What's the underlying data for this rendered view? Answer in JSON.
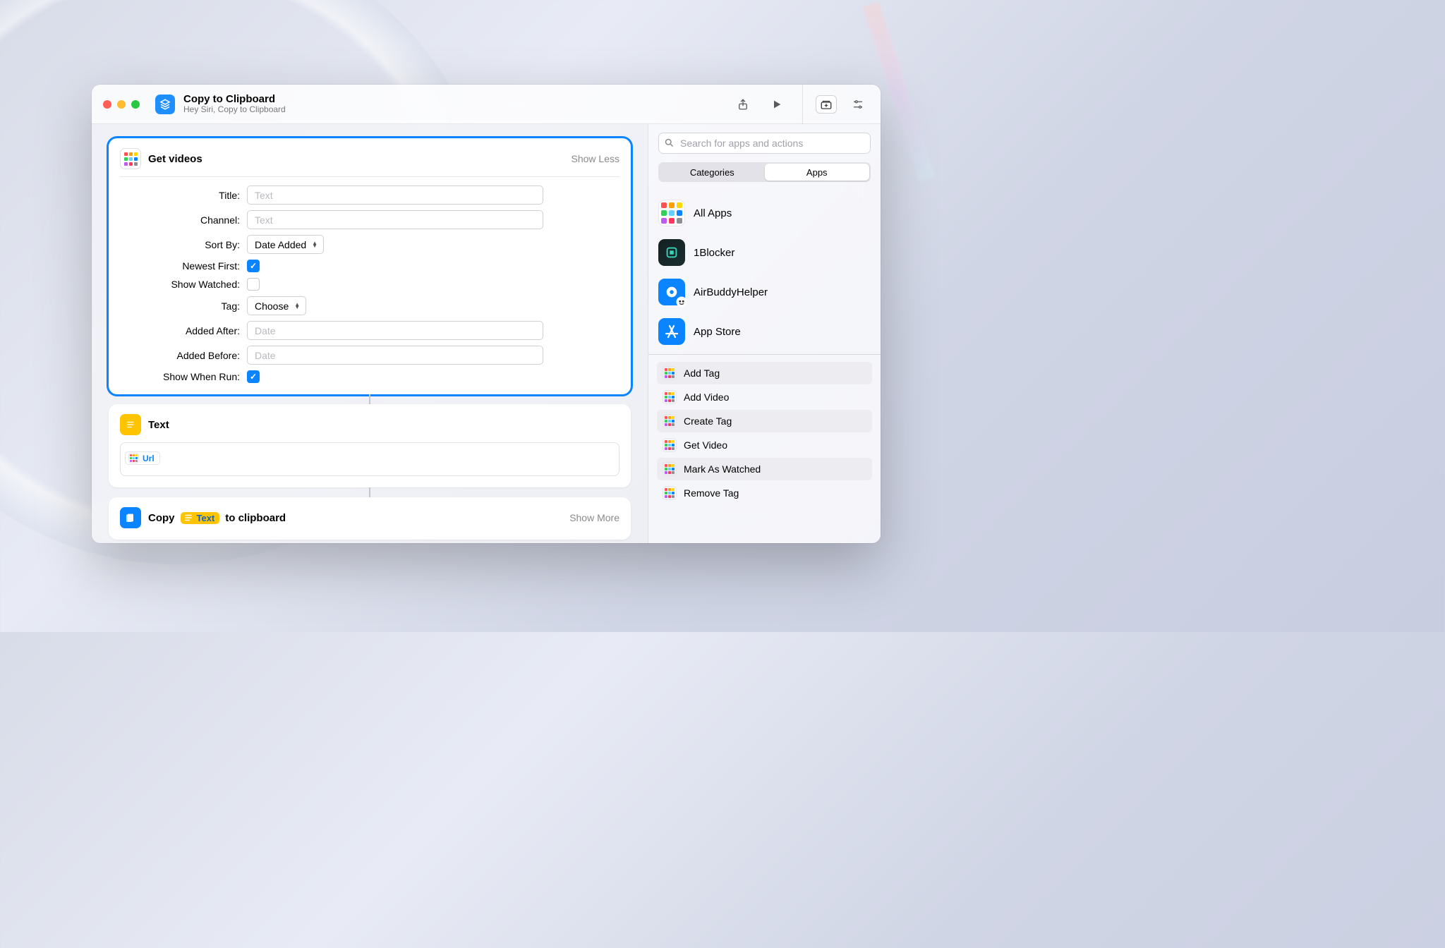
{
  "window": {
    "title": "Copy to Clipboard",
    "subtitle": "Hey Siri, Copy to Clipboard"
  },
  "actions": {
    "getVideos": {
      "title": "Get videos",
      "toggleLabel": "Show Less",
      "fields": {
        "title": {
          "label": "Title:",
          "placeholder": "Text",
          "value": ""
        },
        "channel": {
          "label": "Channel:",
          "placeholder": "Text",
          "value": ""
        },
        "sortBy": {
          "label": "Sort By:",
          "value": "Date Added"
        },
        "newestFirst": {
          "label": "Newest First:",
          "checked": true
        },
        "showWatched": {
          "label": "Show Watched:",
          "checked": false
        },
        "tag": {
          "label": "Tag:",
          "value": "Choose"
        },
        "addedAfter": {
          "label": "Added After:",
          "placeholder": "Date",
          "value": ""
        },
        "addedBefore": {
          "label": "Added Before:",
          "placeholder": "Date",
          "value": ""
        },
        "showWhenRun": {
          "label": "Show When Run:",
          "checked": true
        }
      }
    },
    "text": {
      "title": "Text",
      "variable": "Url"
    },
    "copy": {
      "prefix": "Copy",
      "pill": "Text",
      "suffix": "to clipboard",
      "toggleLabel": "Show More"
    }
  },
  "sidebar": {
    "searchPlaceholder": "Search for apps and actions",
    "segments": {
      "categories": "Categories",
      "apps": "Apps"
    },
    "apps": [
      {
        "label": "All Apps"
      },
      {
        "label": "1Blocker"
      },
      {
        "label": "AirBuddyHelper"
      },
      {
        "label": "App Store"
      }
    ],
    "appActions": [
      {
        "label": "Add Tag"
      },
      {
        "label": "Add Video"
      },
      {
        "label": "Create Tag"
      },
      {
        "label": "Get Video"
      },
      {
        "label": "Mark As Watched"
      },
      {
        "label": "Remove Tag"
      }
    ]
  }
}
